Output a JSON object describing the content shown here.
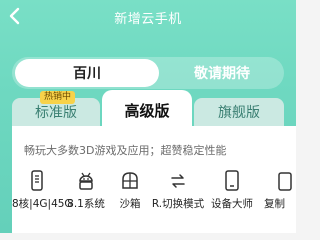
{
  "header": {
    "title": "新增云手机"
  },
  "product_tabs": [
    {
      "label": "百川",
      "active": true
    },
    {
      "label": "敬请期待",
      "active": false
    }
  ],
  "tiers": {
    "standard": {
      "label": "标准版",
      "badge": "热销中"
    },
    "advanced": {
      "label": "高级版",
      "active": true
    },
    "flagship": {
      "label": "旗舰版"
    }
  },
  "card": {
    "description": "畅玩大多数3D游戏及应用；超赞稳定性能",
    "features": [
      {
        "label": "8核|4G|45G",
        "icon": "phone-spec-icon"
      },
      {
        "label": "8.1系统",
        "icon": "android-icon"
      },
      {
        "label": "沙箱",
        "icon": "sandbox-icon"
      },
      {
        "label": "R.切换模式",
        "icon": "switch-mode-icon"
      },
      {
        "label": "设备大师",
        "icon": "device-master-icon"
      },
      {
        "label": "复制",
        "icon": "copy-icon"
      }
    ]
  },
  "colors": {
    "header_bg": "#6fd9c1",
    "tier_inactive_bg": "#cbe9e2",
    "tier_inactive_text": "#3a7f72",
    "badge_bg": "#f7d24a"
  }
}
